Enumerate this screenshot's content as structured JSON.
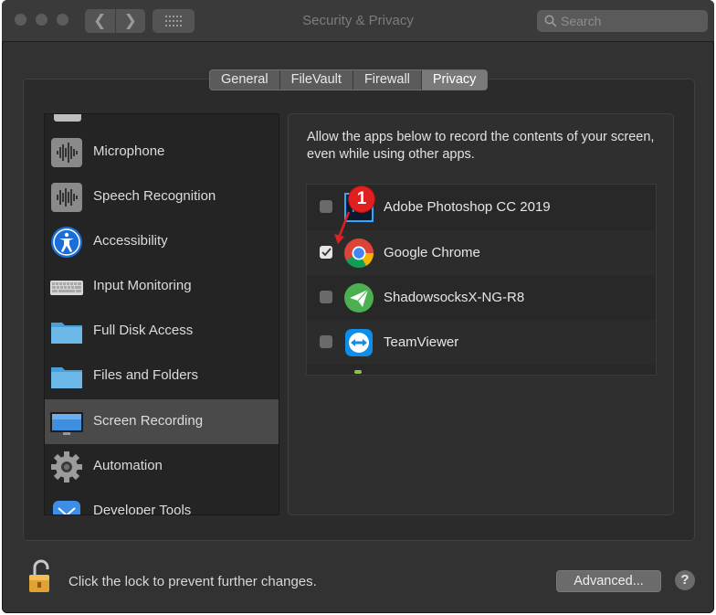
{
  "window": {
    "title": "Security & Privacy",
    "search_placeholder": "Search"
  },
  "tabs": [
    {
      "label": "General",
      "active": false
    },
    {
      "label": "FileVault",
      "active": false
    },
    {
      "label": "Firewall",
      "active": false
    },
    {
      "label": "Privacy",
      "active": true
    }
  ],
  "sidebar": {
    "items": [
      {
        "label": "Microphone",
        "icon": "microphone-waveform-icon"
      },
      {
        "label": "Speech Recognition",
        "icon": "speech-waveform-icon"
      },
      {
        "label": "Accessibility",
        "icon": "accessibility-icon"
      },
      {
        "label": "Input Monitoring",
        "icon": "keyboard-icon"
      },
      {
        "label": "Full Disk Access",
        "icon": "folder-icon"
      },
      {
        "label": "Files and Folders",
        "icon": "folder-icon"
      },
      {
        "label": "Screen Recording",
        "icon": "monitor-icon",
        "selected": true
      },
      {
        "label": "Automation",
        "icon": "gear-icon"
      },
      {
        "label": "Developer Tools",
        "icon": "xcode-icon"
      }
    ]
  },
  "content": {
    "description": "Allow the apps below to record the contents of your screen, even while using other apps.",
    "apps": [
      {
        "name": "Adobe Photoshop CC 2019",
        "checked": false,
        "icon": "photoshop-icon"
      },
      {
        "name": "Google Chrome",
        "checked": true,
        "icon": "chrome-icon"
      },
      {
        "name": "ShadowsocksX-NG-R8",
        "checked": false,
        "icon": "paper-plane-icon"
      },
      {
        "name": "TeamViewer",
        "checked": false,
        "icon": "teamviewer-icon"
      }
    ]
  },
  "annotation": {
    "badge": "1",
    "color": "#e02020"
  },
  "footer": {
    "lock_text": "Click the lock to prevent further changes.",
    "advanced_label": "Advanced...",
    "help_label": "?"
  },
  "colors": {
    "window_bg": "#323232",
    "selected_row": "#4a4a4a",
    "accent_blue": "#1a8cff"
  }
}
